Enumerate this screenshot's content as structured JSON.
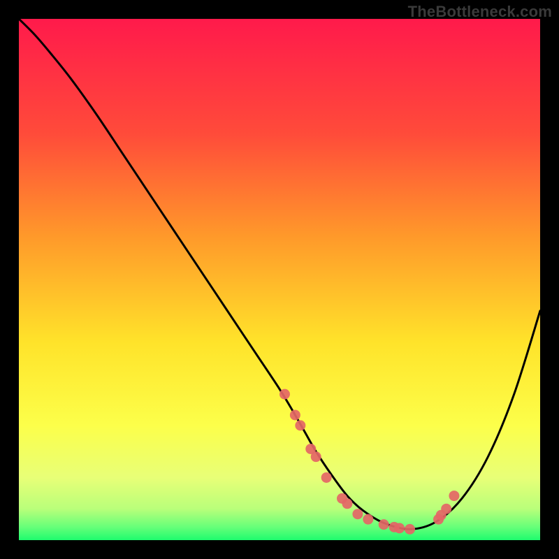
{
  "watermark": "TheBottleneck.com",
  "colors": {
    "gradient_top": "#ff1a4b",
    "gradient_mid_upper": "#ff8a2a",
    "gradient_mid": "#ffe92a",
    "gradient_lower": "#f3ff66",
    "gradient_green": "#3dfc7a",
    "curve": "#000000",
    "points": "#e46666",
    "frame": "#000000"
  },
  "chart_data": {
    "type": "line",
    "title": "",
    "xlabel": "",
    "ylabel": "",
    "xlim": [
      0,
      100
    ],
    "ylim": [
      0,
      100
    ],
    "curve": {
      "name": "bottleneck-curve",
      "x": [
        0,
        3,
        6,
        10,
        15,
        20,
        25,
        30,
        35,
        40,
        45,
        50,
        53,
        55,
        57,
        60,
        63,
        66,
        70,
        75,
        80,
        85,
        90,
        95,
        100
      ],
      "y": [
        100,
        97,
        93.5,
        88.5,
        81.5,
        74,
        66.5,
        59,
        51.5,
        44,
        36.5,
        29,
        24,
        20.5,
        17,
        12.5,
        8.5,
        5.7,
        3.3,
        2.1,
        3.5,
        8,
        16,
        28,
        44
      ]
    },
    "points": {
      "name": "sample-points",
      "x": [
        51,
        53,
        54,
        56,
        57,
        59,
        62,
        63,
        65,
        67,
        70,
        72,
        73,
        75,
        80.5,
        81,
        82,
        83.5
      ],
      "y": [
        28,
        24,
        22,
        17.5,
        16,
        12,
        8,
        7,
        5,
        4,
        3,
        2.5,
        2.3,
        2.1,
        4,
        4.8,
        6,
        8.5
      ]
    }
  }
}
